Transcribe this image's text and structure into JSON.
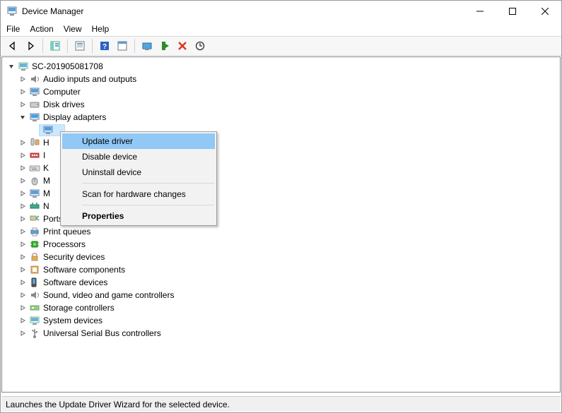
{
  "window": {
    "title": "Device Manager"
  },
  "menubar": {
    "file": "File",
    "action": "Action",
    "view": "View",
    "help": "Help"
  },
  "tree": {
    "root": "SC-201905081708",
    "items": [
      "Audio inputs and outputs",
      "Computer",
      "Disk drives",
      "Display adapters",
      "H",
      "I",
      "K",
      "M",
      "M",
      "N",
      "Ports (COM & LPT)",
      "Print queues",
      "Processors",
      "Security devices",
      "Software components",
      "Software devices",
      "Sound, video and game controllers",
      "Storage controllers",
      "System devices",
      "Universal Serial Bus controllers"
    ]
  },
  "context_menu": {
    "items": [
      "Update driver",
      "Disable device",
      "Uninstall device",
      "Scan for hardware changes",
      "Properties"
    ]
  },
  "statusbar": {
    "text": "Launches the Update Driver Wizard for the selected device."
  }
}
